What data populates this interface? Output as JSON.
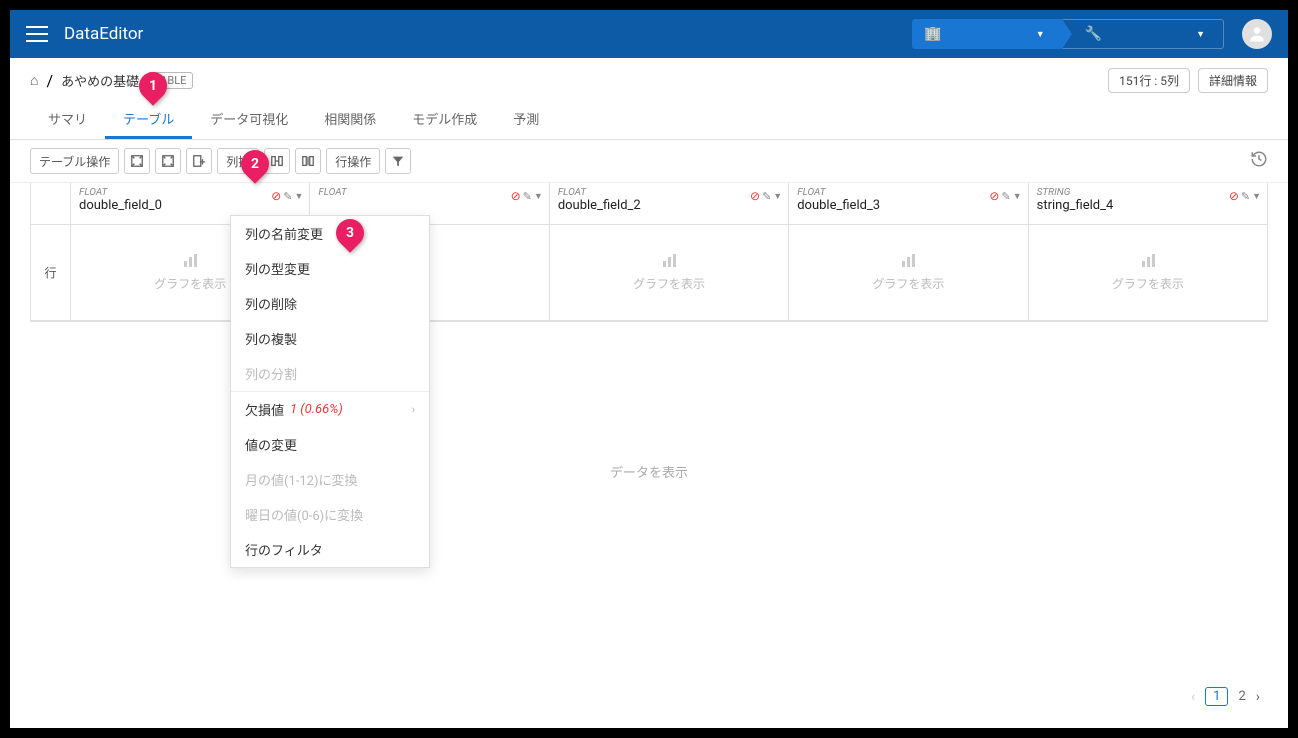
{
  "app": {
    "title": "DataEditor"
  },
  "breadcrumb_top": {
    "first_text": "",
    "second_text": ""
  },
  "breadcrumb": {
    "text": "あやめの基礎",
    "badge": "TABLE"
  },
  "info": {
    "rowcol": "151行 : 5列",
    "detail": "詳細情報"
  },
  "tabs": [
    "サマリ",
    "テーブル",
    "データ可視化",
    "相関関係",
    "モデル作成",
    "予測"
  ],
  "toolbar": {
    "table_ops": "テーブル操作",
    "col_ops": "列操",
    "row_ops": "行操作"
  },
  "row_label": "行",
  "columns": [
    {
      "type": "FLOAT",
      "name": "double_field_0",
      "warn": true
    },
    {
      "type": "FLOAT",
      "name": "",
      "warn": true
    },
    {
      "type": "FLOAT",
      "name": "double_field_2",
      "warn": true
    },
    {
      "type": "FLOAT",
      "name": "double_field_3",
      "warn": true
    },
    {
      "type": "STRING",
      "name": "string_field_4",
      "warn": true
    }
  ],
  "chart_placeholder": "グラフを表示",
  "data_placeholder": "データを表示",
  "menu": {
    "rename": "列の名前変更",
    "retype": "列の型変更",
    "delete": "列の削除",
    "duplicate": "列の複製",
    "split": "列の分割",
    "missing": "欠損値",
    "missing_count": "1 (0.66%)",
    "change_val": "値の変更",
    "month": "月の値(1-12)に変換",
    "weekday": "曜日の値(0-6)に変換",
    "filter": "行のフィルタ"
  },
  "pager": {
    "pages": [
      "1",
      "2"
    ],
    "current": 1
  }
}
